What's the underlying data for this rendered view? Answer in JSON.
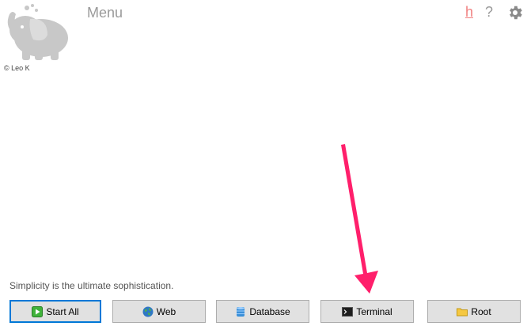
{
  "header": {
    "title": "Menu",
    "copyright": "© Leo K",
    "h_link": "h",
    "help": "?"
  },
  "footer": {
    "tagline": "Simplicity is the ultimate sophistication."
  },
  "buttons": {
    "start_all": "Start All",
    "web": "Web",
    "database": "Database",
    "terminal": "Terminal",
    "root": "Root"
  },
  "icons": {
    "logo": "elephant-logo",
    "settings": "gear-icon",
    "start_all": "play-icon",
    "web": "globe-icon",
    "database": "database-icon",
    "terminal": "terminal-icon",
    "root": "folder-icon"
  },
  "colors": {
    "accent": "#0078d7",
    "h_link": "#f08080",
    "annotation_arrow": "#ff1f6b"
  }
}
